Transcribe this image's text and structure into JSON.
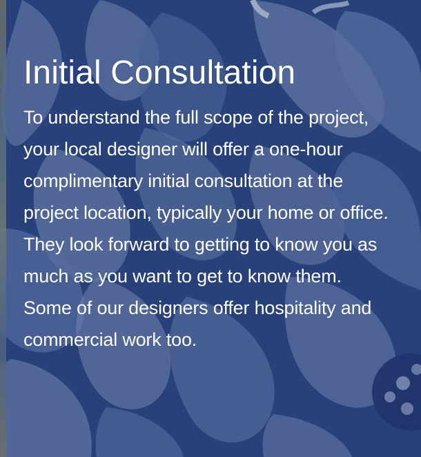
{
  "section": {
    "title": "Initial Consultation",
    "body_lines": [
      "To understand the full scope of the project,",
      "your local designer will offer a one-hour",
      "complimentary initial consultation at the",
      "project location, typically your home or office.",
      "They look forward to getting to know you as",
      "much as you want to get to know them.",
      "Some of our designers offer hospitality and",
      "commercial work too."
    ]
  },
  "colors": {
    "background": "#2a457f",
    "pattern_light": "#7f92b9",
    "pattern_mid": "#4f679b",
    "text": "#ffffff"
  }
}
